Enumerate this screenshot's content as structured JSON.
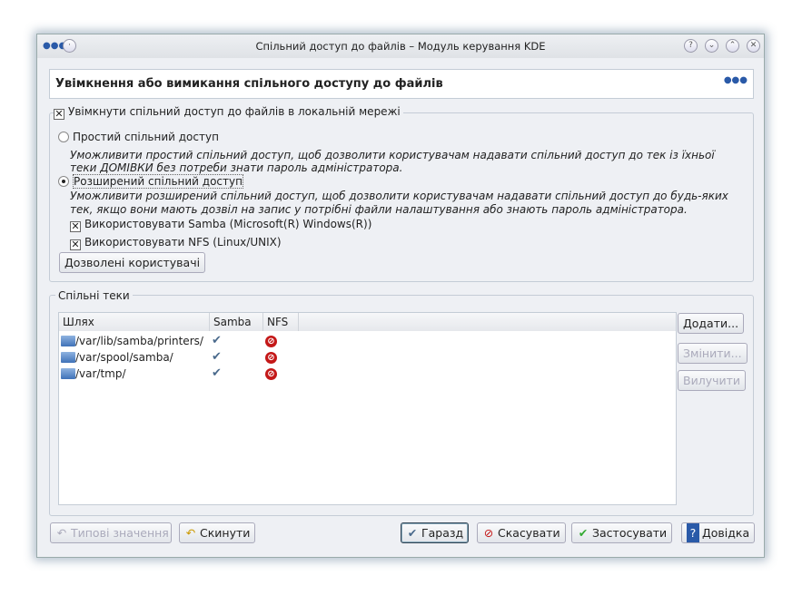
{
  "window": {
    "title": "Спільний доступ до файлів – Модуль керування KDE",
    "buttons": [
      "?",
      "⌄",
      "⌃",
      "✕"
    ]
  },
  "header": {
    "title": "Увімкнення або вимикання спільного доступу до файлів"
  },
  "sharing": {
    "enable_label": "Увімкнути спільний доступ до файлів в локальній мережі",
    "enable_checked": true,
    "simple_label": "Простий спільний доступ",
    "simple_desc1": "Уможливити простий спільний доступ, щоб дозволити користувачам надавати спільний доступ до тек із їхньої",
    "simple_desc2": "теки ДОМІВКИ без потреби знати пароль адміністратора.",
    "advanced_label": "Розширений спільний доступ",
    "advanced_selected": true,
    "advanced_desc1": "Уможливити розширений спільний доступ, щоб дозволити користувачам надавати спільний доступ до будь-яких",
    "advanced_desc2": "тек, якщо вони мають дозвіл на запис у потрібні файли налаштування або знають пароль адміністратора.",
    "samba_label": "Використовувати Samba (Microsoft(R) Windows(R))",
    "nfs_label": "Використовувати NFS (Linux/UNIX)",
    "allowed_users_button": "Дозволені користувачі"
  },
  "folders": {
    "title": "Спільні теки",
    "columns": [
      "Шлях",
      "Samba",
      "NFS"
    ],
    "rows": [
      {
        "path": "/var/lib/samba/printers/",
        "samba": "✔",
        "nfs": "⊘"
      },
      {
        "path": "/var/spool/samba/",
        "samba": "✔",
        "nfs": "⊘"
      },
      {
        "path": "/var/tmp/",
        "samba": "✔",
        "nfs": "⊘"
      }
    ],
    "add": "Додати...",
    "modify": "Змінити...",
    "remove": "Вилучити"
  },
  "footer": {
    "defaults": "Типові значення",
    "reset": "Скинути",
    "ok": "Гаразд",
    "cancel": "Скасувати",
    "apply": "Застосувати",
    "help": "Довідка"
  }
}
